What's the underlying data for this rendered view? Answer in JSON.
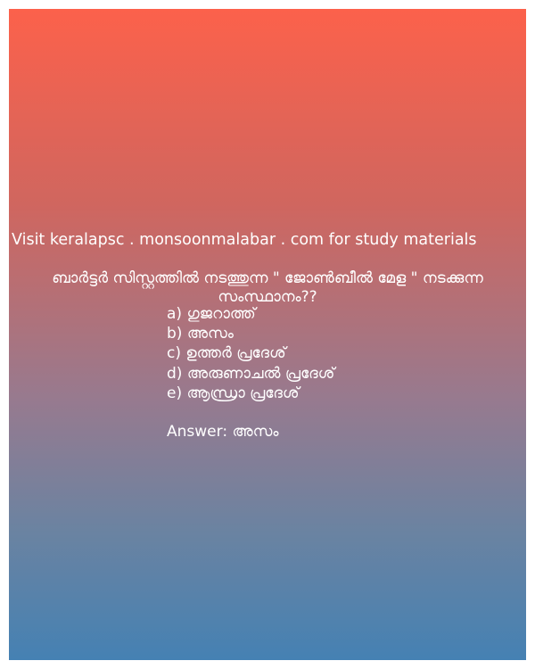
{
  "site_line": "Visit keralapsc . monsoonmalabar . com for study materials",
  "question": {
    "line1": "ബാർട്ടർ  സിസ്റ്റത്തിൽ  നടത്തുന്ന \" ജോൺബീൽ മേള \" നടക്കുന്ന",
    "line2": "സംസ്ഥാനം??"
  },
  "options": [
    "a) ഗുജറാത്ത്",
    "b) അസം",
    "c) ഉത്തർ  പ്രദേശ്",
    "d) അരുണാചൽ  പ്രദേശ്",
    "e) ആന്ധ്രാ  പ്രദേശ്"
  ],
  "answer": {
    "label": "Answer:",
    "value": "അസം"
  }
}
